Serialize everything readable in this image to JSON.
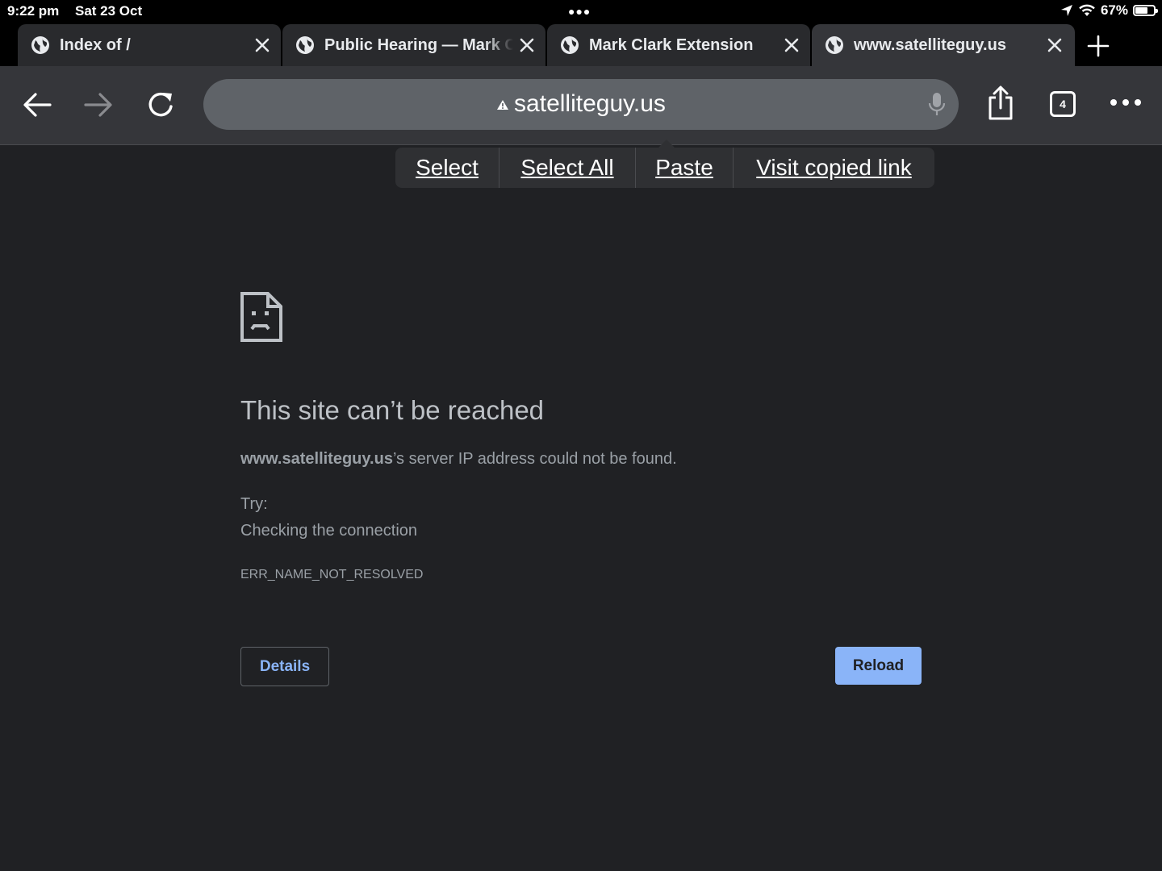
{
  "status_bar": {
    "time": "9:22 pm",
    "date": "Sat 23 Oct",
    "battery_text": "67%",
    "battery_level": 0.67
  },
  "tabs": [
    {
      "title": "Index of /",
      "active": false
    },
    {
      "title": "Public Hearing — Mark C",
      "active": false
    },
    {
      "title": "Mark Clark Extension",
      "active": false
    },
    {
      "title": "www.satelliteguy.us",
      "active": true
    }
  ],
  "toolbar": {
    "url": "satelliteguy.us",
    "tab_count": "4"
  },
  "context_menu": {
    "items": [
      "Select",
      "Select All",
      "Paste",
      "Visit copied link"
    ]
  },
  "error_page": {
    "title": "This site can’t be reached",
    "host": "www.satelliteguy.us",
    "description_suffix": "’s server IP address could not be found.",
    "try_label": "Try:",
    "suggestion": "Checking the connection",
    "error_code": "ERR_NAME_NOT_RESOLVED",
    "details_label": "Details",
    "reload_label": "Reload"
  },
  "colors": {
    "page_background": "#202124",
    "button_accent": "#8ab4f8",
    "omnibox": "#5f6368"
  }
}
